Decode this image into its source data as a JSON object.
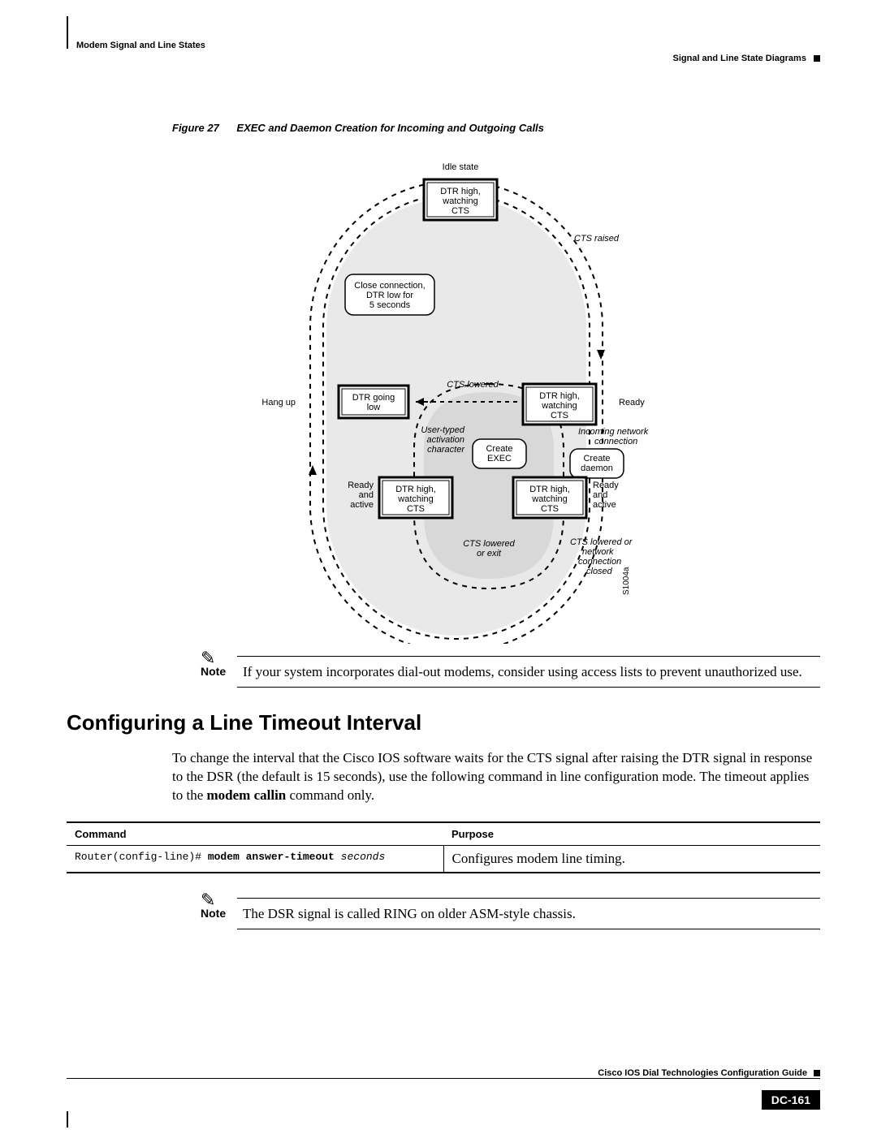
{
  "header": {
    "left": "Modem Signal and Line States",
    "right": "Signal and Line State Diagrams"
  },
  "figure": {
    "number": "Figure 27",
    "title": "EXEC and Daemon Creation for Incoming and Outgoing Calls",
    "labels": {
      "idle_state": "Idle state",
      "dtr_high_cts_top": "DTR high,\nwatching\nCTS",
      "cts_raised": "CTS raised",
      "close_conn": "Close connection,\nDTR low for\n5 seconds",
      "hang_up": "Hang up",
      "dtr_going_low": "DTR going\nlow",
      "cts_lowered_mid": "CTS lowered",
      "dtr_high_cts_right": "DTR high,\nwatching\nCTS",
      "ready": "Ready",
      "user_typed": "User-typed\nactivation\ncharacter",
      "create_exec": "Create\nEXEC",
      "incoming_net": "Incoming network\nconnection",
      "create_daemon": "Create\ndaemon",
      "ready_active_left": "Ready\nand\nactive",
      "dtr_high_cts_bl": "DTR high,\nwatching\nCTS",
      "dtr_high_cts_br": "DTR high,\nwatching\nCTS",
      "ready_active_right": "Ready\nand\nactive",
      "cts_lowered_exit": "CTS lowered\nor exit",
      "cts_lowered_closed": "CTS lowered or\nnetwork\nconnection\nclosed",
      "diagram_id": "S1004a"
    }
  },
  "note1": {
    "label": "Note",
    "text": "If your system incorporates dial-out modems, consider using access lists to prevent unauthorized use."
  },
  "section_heading": "Configuring a Line Timeout Interval",
  "body_paragraph": {
    "pre": "To change the interval that the Cisco IOS software waits for the CTS signal after raising the DTR signal in response to the DSR (the default is 15 seconds), use the following command in line configuration mode. The timeout applies to the ",
    "bold": "modem callin",
    "post": " command only."
  },
  "table": {
    "headers": {
      "command": "Command",
      "purpose": "Purpose"
    },
    "row": {
      "prompt": "Router(config-line)# ",
      "cmd": "modem answer-timeout",
      "arg": " seconds",
      "purpose": "Configures modem line timing."
    }
  },
  "note2": {
    "label": "Note",
    "text": "The DSR signal is called RING on older ASM-style chassis."
  },
  "footer": {
    "guide": "Cisco IOS Dial Technologies Configuration Guide",
    "page": "DC-161"
  }
}
